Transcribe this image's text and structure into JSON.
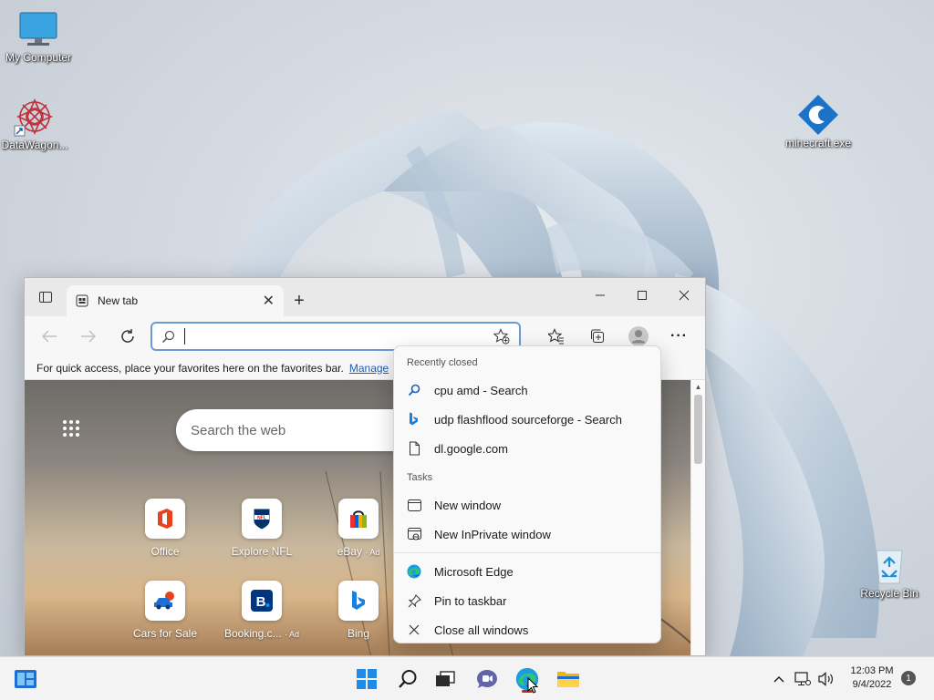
{
  "desktop": {
    "icons": [
      {
        "label": "My Computer",
        "icon": "monitor-icon"
      },
      {
        "label": "DataWagon...",
        "icon": "datawagon-shortcut-icon"
      },
      {
        "label": "minecraft.exe",
        "icon": "minecraft-exe-icon"
      },
      {
        "label": "Recycle Bin",
        "icon": "recycle-bin-icon"
      }
    ]
  },
  "browser": {
    "tab_title": "New tab",
    "address_placeholder": "",
    "favorites_bar_text": "For quick access, place your favorites here on the favorites bar.",
    "favorites_bar_link": "Manage",
    "web_search_placeholder": "Search the web",
    "tiles": [
      {
        "label": "Office",
        "ad": ""
      },
      {
        "label": "Explore NFL",
        "ad": ""
      },
      {
        "label": "eBay",
        "ad": "· Ad"
      },
      {
        "label": "Cars for Sale",
        "ad": ""
      },
      {
        "label": "Booking.c...",
        "ad": "· Ad"
      },
      {
        "label": "Bing",
        "ad": ""
      }
    ]
  },
  "jumplist": {
    "recently_closed_header": "Recently closed",
    "recently_closed": [
      {
        "label": "cpu amd - Search",
        "icon": "search-icon"
      },
      {
        "label": "udp flashflood sourceforge - Search",
        "icon": "bing-icon"
      },
      {
        "label": "dl.google.com",
        "icon": "page-icon"
      }
    ],
    "tasks_header": "Tasks",
    "tasks": [
      {
        "label": "New window",
        "icon": "window-icon"
      },
      {
        "label": "New InPrivate window",
        "icon": "inprivate-window-icon"
      }
    ],
    "app_items": [
      {
        "label": "Microsoft Edge",
        "icon": "edge-icon"
      },
      {
        "label": "Pin to taskbar",
        "icon": "pin-icon"
      },
      {
        "label": "Close all windows",
        "icon": "close-icon"
      }
    ]
  },
  "taskbar": {
    "time": "12:03 PM",
    "date": "9/4/2022",
    "notification_count": "1"
  },
  "colors": {
    "accent": "#0067c0",
    "active_indicator": "#c42b1c",
    "link": "#1a5fb4"
  }
}
